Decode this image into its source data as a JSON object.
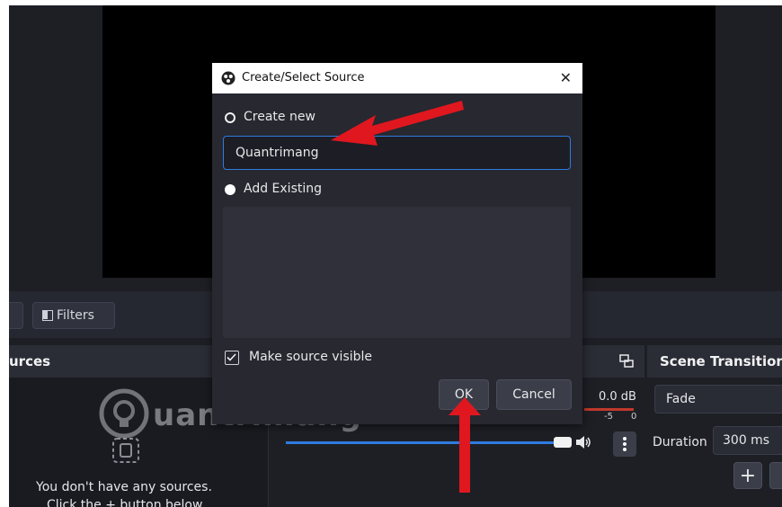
{
  "toolbar": {
    "filters_label": "Filters"
  },
  "sources": {
    "title": "urces",
    "empty_line1": "You don't have any sources.",
    "empty_line2": "Click the + button below"
  },
  "mixer": {
    "db_value": "0.0 dB",
    "scale_a": "-5",
    "scale_b": "0"
  },
  "transitions": {
    "title": "Scene Transitions",
    "selected": "Fade",
    "duration_label": "Duration",
    "duration_value": "300 ms",
    "add_symbol": "+"
  },
  "dialog": {
    "title": "Create/Select Source",
    "close_symbol": "✕",
    "create_new_label": "Create new",
    "name_value": "Quantrimang",
    "add_existing_label": "Add Existing",
    "visible_label": "Make source visible",
    "visible_checked": true,
    "ok_label": "OK",
    "cancel_label": "Cancel"
  },
  "watermark": {
    "text": "uantrimang"
  },
  "colors": {
    "accent_blue": "#2f7be0",
    "arrow_red": "#e0171f",
    "bg_dark": "#1e1f25"
  }
}
